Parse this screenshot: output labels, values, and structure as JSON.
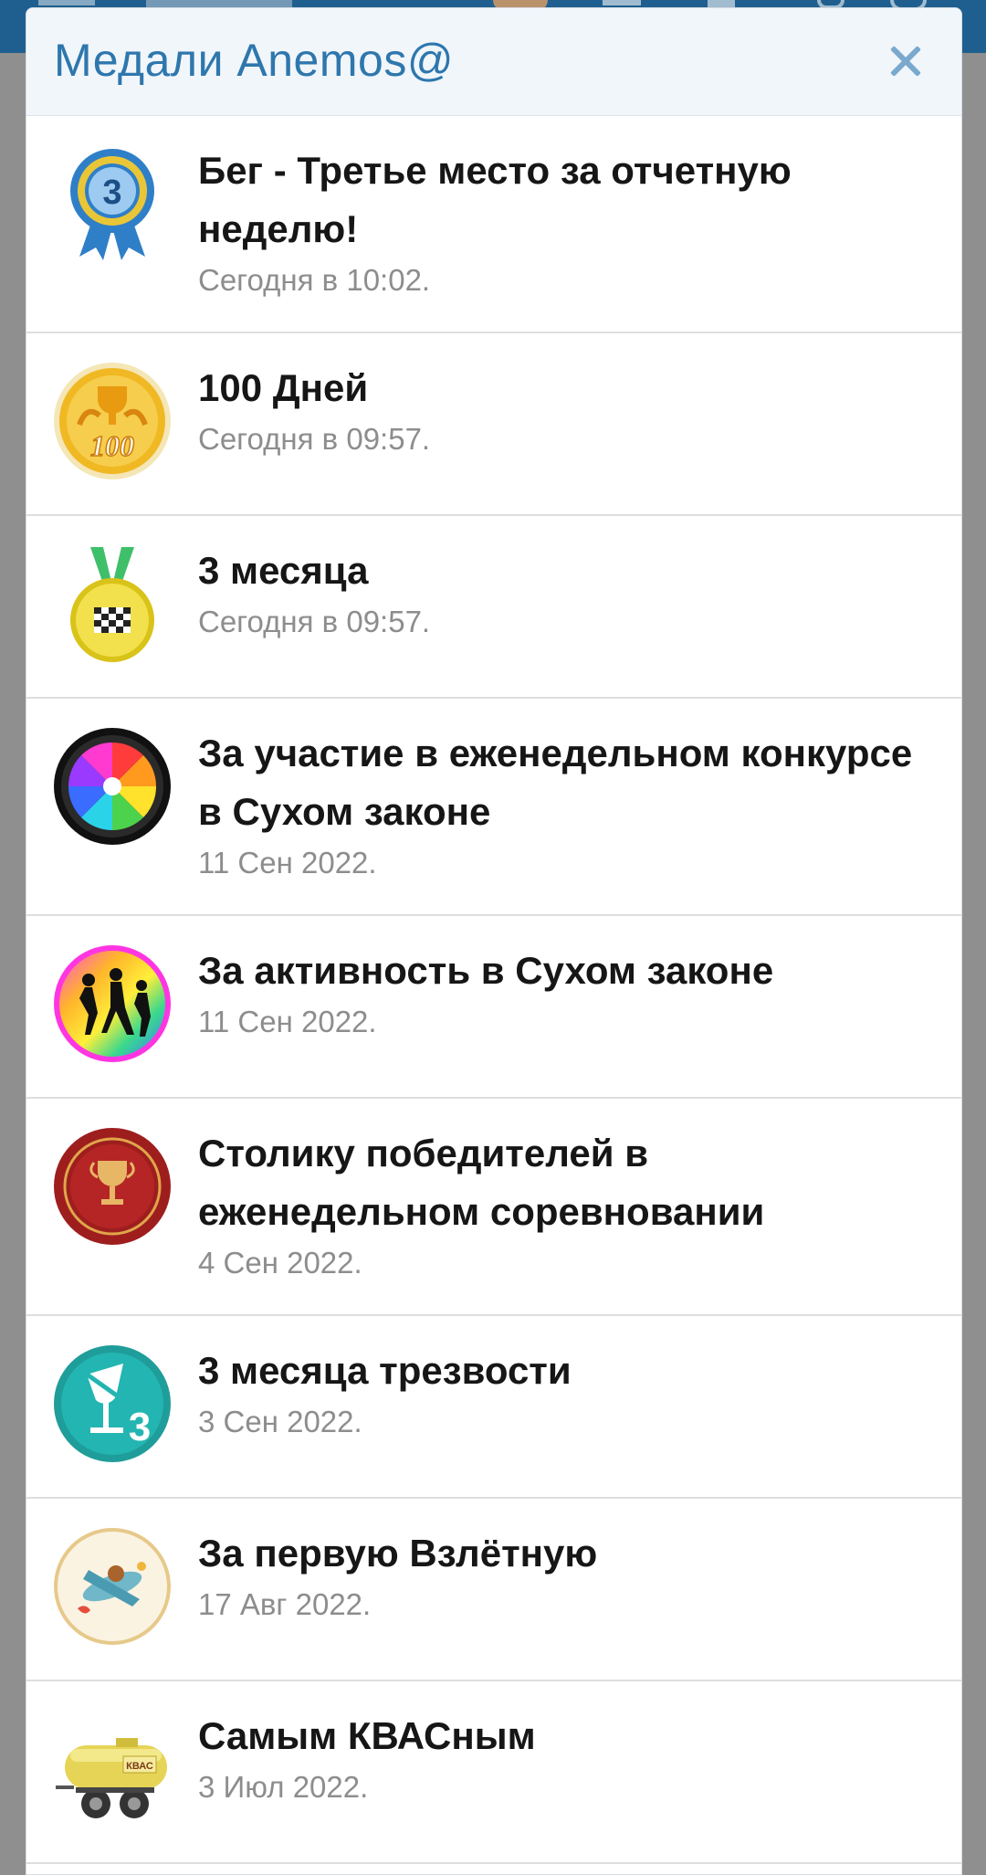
{
  "dialog": {
    "title": "Медали Anemos@",
    "close_glyph": "✕"
  },
  "medals": [
    {
      "title": "Бег - Третье место за отчетную неделю!",
      "date": "Сегодня в 10:02.",
      "icon": "third-place-ribbon-icon"
    },
    {
      "title": "100 Дней",
      "date": "Сегодня в 09:57.",
      "icon": "gold-100-days-icon"
    },
    {
      "title": "3 месяца",
      "date": "Сегодня в 09:57.",
      "icon": "checkered-medal-icon"
    },
    {
      "title": "За участие в еженедельном конкурсе в Сухом законе",
      "date": "11 Сен 2022.",
      "icon": "rainbow-wheel-icon"
    },
    {
      "title": "За активность в Сухом законе",
      "date": "11 Сен 2022.",
      "icon": "dancers-icon"
    },
    {
      "title": "Столику победителей в еженедельном соревновании",
      "date": "4 Сен 2022.",
      "icon": "trophy-icon"
    },
    {
      "title": "3 месяца трезвости",
      "date": "3 Сен 2022.",
      "icon": "glass-3-icon"
    },
    {
      "title": "За первую Взлётную",
      "date": "17 Авг 2022.",
      "icon": "airplane-icon"
    },
    {
      "title": "Самым КВАСным",
      "date": "3 Июл 2022.",
      "icon": "kvass-tank-icon"
    }
  ],
  "icon_texts": {
    "third_place": "3",
    "hundred": "100",
    "glass": "3",
    "kvass": "КВАС"
  },
  "colors": {
    "header_bg": "#f1f6fb",
    "title": "#2e77ad",
    "close": "#7aa9cd",
    "date": "#8d8d8d",
    "backdrop": "#8f8f8f",
    "topbar": "#1f5f8f"
  }
}
